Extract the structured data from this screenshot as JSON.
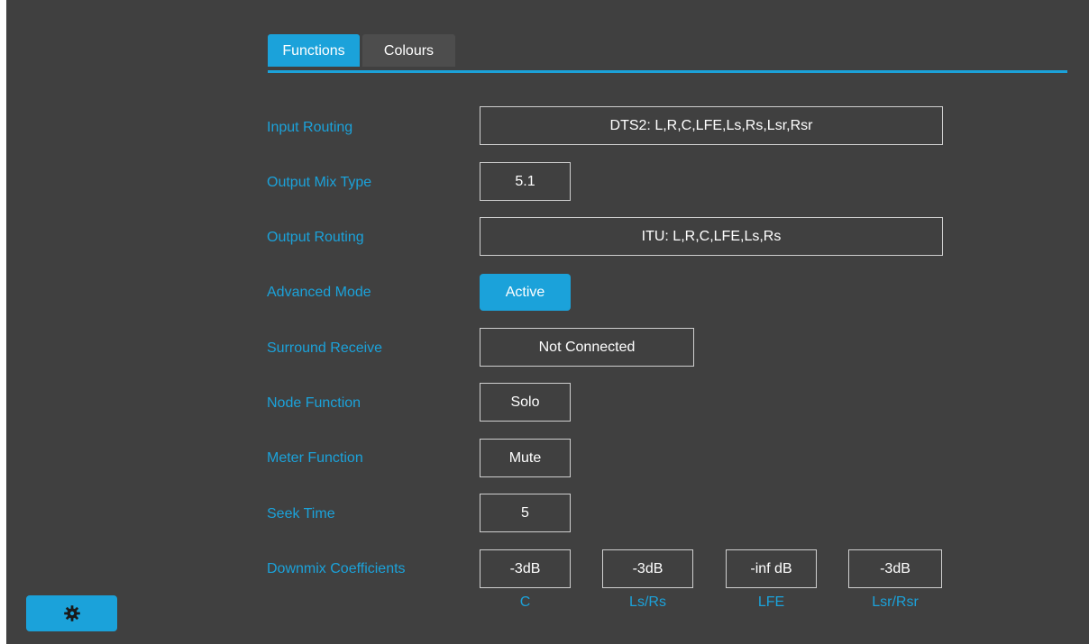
{
  "tabs": [
    {
      "label": "Functions",
      "active": true
    },
    {
      "label": "Colours",
      "active": false
    }
  ],
  "settings": {
    "input_routing": {
      "label": "Input Routing",
      "value": "DTS2: L,R,C,LFE,Ls,Rs,Lsr,Rsr"
    },
    "output_mix_type": {
      "label": "Output Mix Type",
      "value": "5.1"
    },
    "output_routing": {
      "label": "Output Routing",
      "value": "ITU: L,R,C,LFE,Ls,Rs"
    },
    "advanced_mode": {
      "label": "Advanced Mode",
      "value": "Active"
    },
    "surround_receive": {
      "label": "Surround Receive",
      "value": "Not Connected"
    },
    "node_function": {
      "label": "Node Function",
      "value": "Solo"
    },
    "meter_function": {
      "label": "Meter Function",
      "value": "Mute"
    },
    "seek_time": {
      "label": "Seek Time",
      "value": "5"
    },
    "downmix": {
      "label": "Downmix Coefficients",
      "coefficients": [
        {
          "value": "-3dB",
          "channel": "C"
        },
        {
          "value": "-3dB",
          "channel": "Ls/Rs"
        },
        {
          "value": "-inf dB",
          "channel": "LFE"
        },
        {
          "value": "-3dB",
          "channel": "Lsr/Rsr"
        }
      ]
    }
  },
  "footer": {
    "settings_icon": "gear-icon"
  },
  "colors": {
    "accent": "#1ba2da",
    "background": "#404040",
    "text": "#ffffff"
  }
}
